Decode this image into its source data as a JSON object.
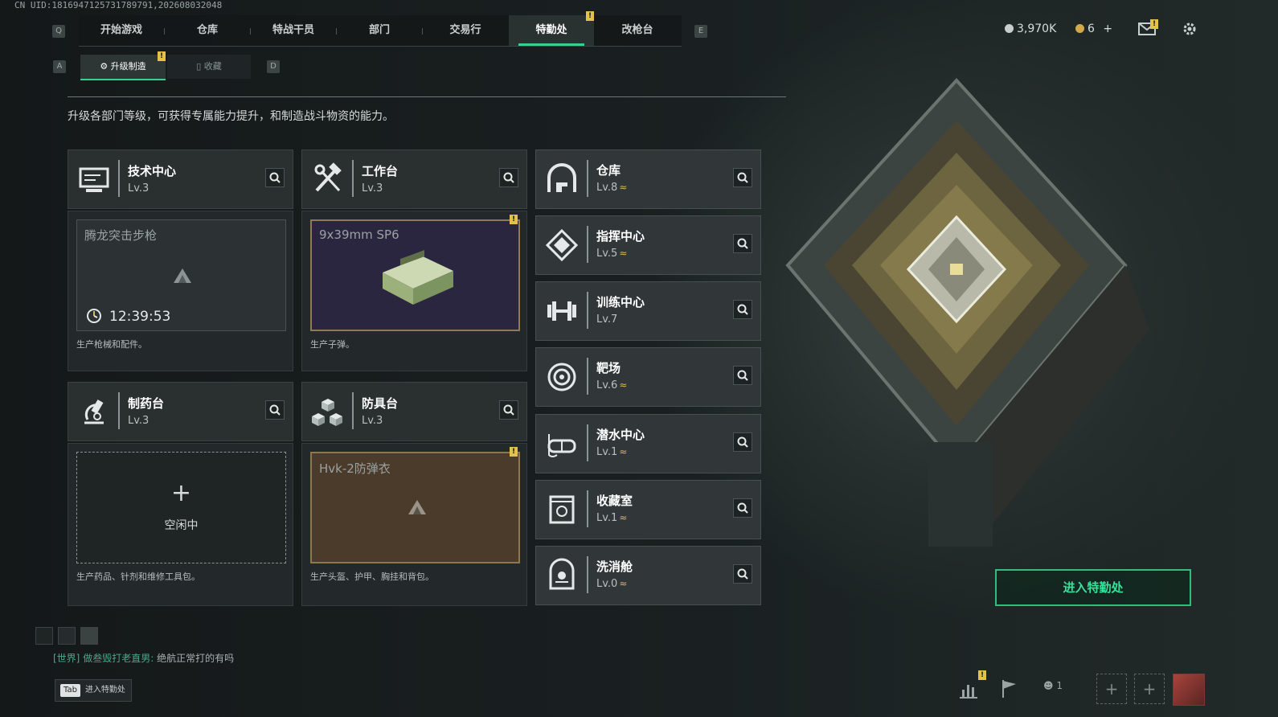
{
  "uid": "CN UID:1816947125731789791,202608032048",
  "nav": {
    "left_key": "Q",
    "right_key": "E",
    "tabs": [
      {
        "label": "开始游戏"
      },
      {
        "label": "仓库"
      },
      {
        "label": "特战干员"
      },
      {
        "label": "部门"
      },
      {
        "label": "交易行"
      },
      {
        "label": "特勤处",
        "active": true
      },
      {
        "label": "改枪台"
      }
    ]
  },
  "currency": {
    "coins": "3,970K",
    "tickets": "6",
    "plus": "+"
  },
  "subtabs": {
    "left_key": "A",
    "right_key": "D",
    "upgrade": "升级制造",
    "collect": "收藏"
  },
  "description": "升级各部门等级，可获得专属能力提升，和制造战斗物资的能力。",
  "departments": [
    {
      "name": "技术中心",
      "level": "Lv.3",
      "slot_title": "腾龙突击步枪",
      "timer": "12:39:53",
      "footer": "生产枪械和配件。"
    },
    {
      "name": "工作台",
      "level": "Lv.3",
      "slot_title": "9x39mm SP6",
      "footer": "生产子弹。"
    },
    {
      "name": "制药台",
      "level": "Lv.3",
      "slot_idle_label": "空闲中",
      "footer": "生产药品、针剂和维修工具包。"
    },
    {
      "name": "防具台",
      "level": "Lv.3",
      "slot_title": "Hvk-2防弹衣",
      "footer": "生产头盔、护甲、胸挂和背包。"
    }
  ],
  "facilities": [
    {
      "name": "仓库",
      "level": "Lv.8",
      "upgradable": true,
      "icon": "vault-icon"
    },
    {
      "name": "指挥中心",
      "level": "Lv.5",
      "upgradable": true,
      "icon": "command-icon"
    },
    {
      "name": "训练中心",
      "level": "Lv.7",
      "upgradable": false,
      "icon": "dumbbell-icon"
    },
    {
      "name": "靶场",
      "level": "Lv.6",
      "upgradable": true,
      "icon": "target-icon"
    },
    {
      "name": "潜水中心",
      "level": "Lv.1",
      "upgradable": true,
      "icon": "diving-mask-icon"
    },
    {
      "name": "收藏室",
      "level": "Lv.1",
      "upgradable": true,
      "icon": "collection-icon"
    },
    {
      "name": "洗消舱",
      "level": "Lv.0",
      "upgradable": true,
      "icon": "hazmat-icon"
    }
  ],
  "enter_button": "进入特勤处",
  "chat": {
    "tag": "[世界]",
    "user": "做叁毁打老直男:",
    "message": "绝航正常打的有吗"
  },
  "tab_hint": {
    "key": "Tab",
    "label": "进入特勤处"
  },
  "party_count": "1",
  "badge_mark": "!",
  "colors": {
    "accent": "#39d08e",
    "warning": "#e3c24b",
    "upgrade": "#d9b65a"
  }
}
